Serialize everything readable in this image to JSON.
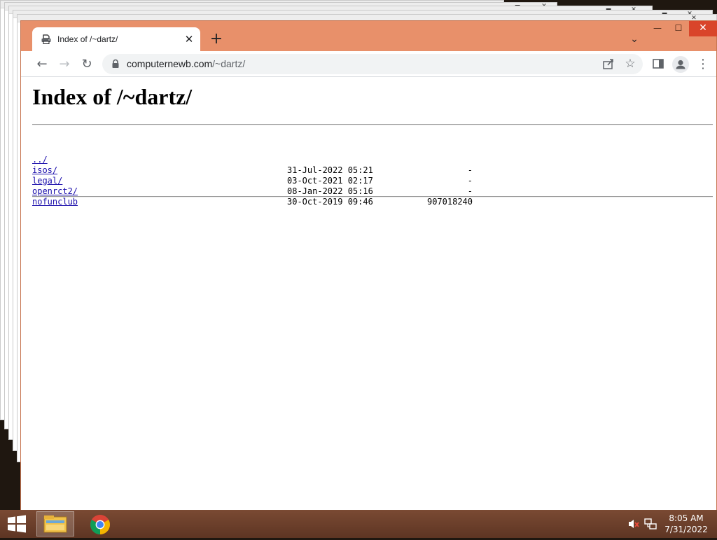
{
  "browser": {
    "tab": {
      "title": "Index of /~dartz/",
      "close": "✕"
    },
    "new_tab": "+",
    "tab_search": "⌄",
    "window_controls": {
      "minimize": "—",
      "maximize": "☐",
      "close": "✕"
    },
    "nav": {
      "back": "←",
      "forward": "→",
      "reload": "↻"
    },
    "address": {
      "host": "computernewb.com",
      "path": "/~dartz/"
    },
    "menu": "⋮",
    "star": "☆",
    "colors": {
      "frame": "#e8906a",
      "close_button": "#d9452a",
      "link": "#1a0dab"
    }
  },
  "page": {
    "heading": "Index of /~dartz/",
    "entries": [
      {
        "name": "../",
        "date": "",
        "size": ""
      },
      {
        "name": "isos/",
        "date": "31-Jul-2022 05:21",
        "size": "-"
      },
      {
        "name": "legal/",
        "date": "03-Oct-2021 02:17",
        "size": "-"
      },
      {
        "name": "openrct2/",
        "date": "08-Jan-2022 05:16",
        "size": "-"
      },
      {
        "name": "nofunclub",
        "date": "30-Oct-2019 09:46",
        "size": "907018240"
      }
    ]
  },
  "taskbar": {
    "clock": {
      "time": "8:05 AM",
      "date": "7/31/2022"
    },
    "icons": [
      "windows-start-icon",
      "file-explorer-icon",
      "chrome-icon",
      "speaker-muted-icon",
      "network-icon"
    ]
  },
  "background_windows": {
    "close": "✕",
    "minimize": "▬"
  }
}
